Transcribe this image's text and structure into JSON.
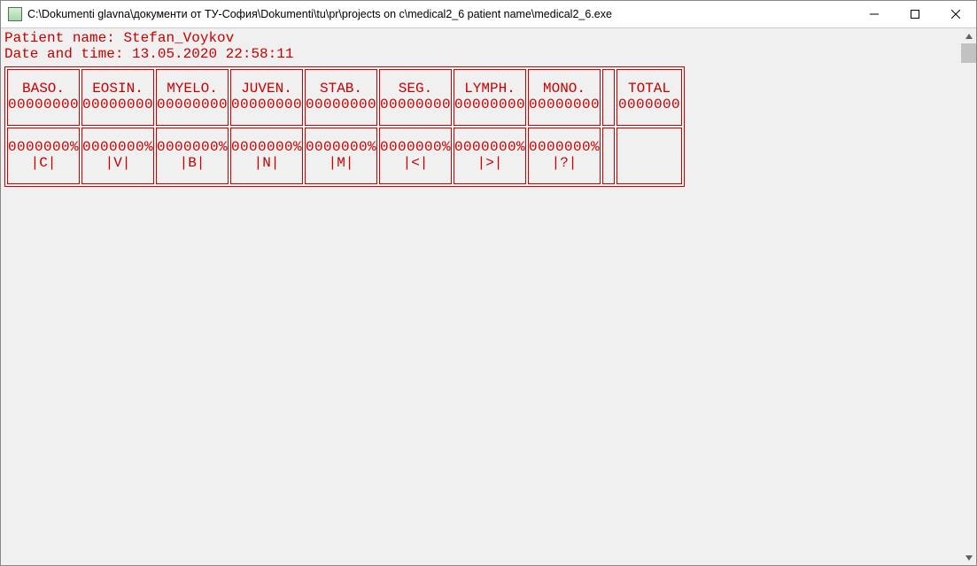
{
  "window": {
    "title": "C:\\Dokumenti glavna\\документи от ТУ-София\\Dokumenti\\tu\\pr\\projects on c\\medical2_6 patient name\\medical2_6.exe"
  },
  "header": {
    "patient_label": "Patient name:",
    "patient_value": "Stefan_Voykov",
    "datetime_label": "Date and time:",
    "datetime_value": "13.05.2020 22:58:11"
  },
  "columns": [
    {
      "name": "BASO.",
      "count": "00000000",
      "pct": "0000000%",
      "key": "|C|"
    },
    {
      "name": "EOSIN.",
      "count": "00000000",
      "pct": "0000000%",
      "key": "|V|"
    },
    {
      "name": "MYELO.",
      "count": "00000000",
      "pct": "0000000%",
      "key": "|B|"
    },
    {
      "name": "JUVEN.",
      "count": "00000000",
      "pct": "0000000%",
      "key": "|N|"
    },
    {
      "name": "STAB.",
      "count": "00000000",
      "pct": "0000000%",
      "key": "|M|"
    },
    {
      "name": "SEG.",
      "count": "00000000",
      "pct": "0000000%",
      "key": "|<|"
    },
    {
      "name": "LYMPH.",
      "count": "00000000",
      "pct": "0000000%",
      "key": "|>|"
    },
    {
      "name": "MONO.",
      "count": "00000000",
      "pct": "0000000%",
      "key": "|?|"
    }
  ],
  "total": {
    "label": "TOTAL",
    "value": "0000000"
  }
}
